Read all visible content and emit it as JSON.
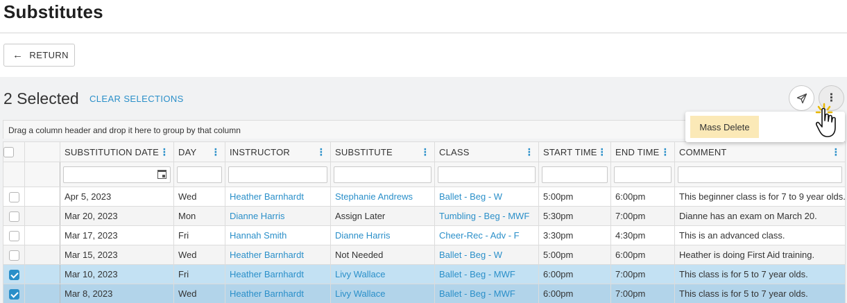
{
  "page": {
    "title": "Substitutes"
  },
  "toolbar": {
    "return_label": "RETURN"
  },
  "selection": {
    "count_text": "2 Selected",
    "clear_label": "CLEAR SELECTIONS"
  },
  "grid": {
    "group_hint": "Drag a column header and drop it here to group by that column",
    "columns": [
      "SUBSTITUTION DATE",
      "DAY",
      "INSTRUCTOR",
      "SUBSTITUTE",
      "CLASS",
      "START TIME",
      "END TIME",
      "COMMENT"
    ],
    "rows": [
      {
        "checked": false,
        "date": "Apr 5, 2023",
        "day": "Wed",
        "instructor": "Heather Barnhardt",
        "substitute": "Stephanie Andrews",
        "substitute_link": true,
        "class": "Ballet - Beg - W",
        "start": "5:00pm",
        "end": "6:00pm",
        "comment": "This beginner class is for 7 to 9 year olds."
      },
      {
        "checked": false,
        "date": "Mar 20, 2023",
        "day": "Mon",
        "instructor": "Dianne Harris",
        "substitute": "Assign Later",
        "substitute_link": false,
        "class": "Tumbling - Beg - MWF",
        "start": "5:30pm",
        "end": "7:00pm",
        "comment": "Dianne has an exam on March 20."
      },
      {
        "checked": false,
        "date": "Mar 17, 2023",
        "day": "Fri",
        "instructor": "Hannah Smith",
        "substitute": "Dianne Harris",
        "substitute_link": true,
        "class": "Cheer-Rec - Adv - F",
        "start": "3:30pm",
        "end": "4:30pm",
        "comment": "This is an advanced class."
      },
      {
        "checked": false,
        "date": "Mar 15, 2023",
        "day": "Wed",
        "instructor": "Heather Barnhardt",
        "substitute": "Not Needed",
        "substitute_link": false,
        "class": "Ballet - Beg - W",
        "start": "5:00pm",
        "end": "6:00pm",
        "comment": "Heather is doing First Aid training."
      },
      {
        "checked": true,
        "date": "Mar 10, 2023",
        "day": "Fri",
        "instructor": "Heather Barnhardt",
        "substitute": "Livy Wallace",
        "substitute_link": true,
        "class": "Ballet - Beg - MWF",
        "start": "6:00pm",
        "end": "7:00pm",
        "comment": "This class is for 5 to 7 year olds."
      },
      {
        "checked": true,
        "date": "Mar 8, 2023",
        "day": "Wed",
        "instructor": "Heather Barnhardt",
        "substitute": "Livy Wallace",
        "substitute_link": true,
        "class": "Ballet - Beg - MWF",
        "start": "6:00pm",
        "end": "7:00pm",
        "comment": "This class is for 5 to 7 year olds."
      }
    ]
  },
  "menu": {
    "items": [
      {
        "label": "Mass Delete"
      }
    ]
  },
  "colors": {
    "accent": "#2a8fc9",
    "menu_highlight": "#fbe9b7",
    "selected_row": "#c3e1f3"
  },
  "icons": {
    "return": "arrow-left-icon",
    "send": "paper-plane-icon",
    "more": "kebab-icon",
    "calendar": "calendar-icon",
    "cursor": "hand-pointer-icon"
  }
}
